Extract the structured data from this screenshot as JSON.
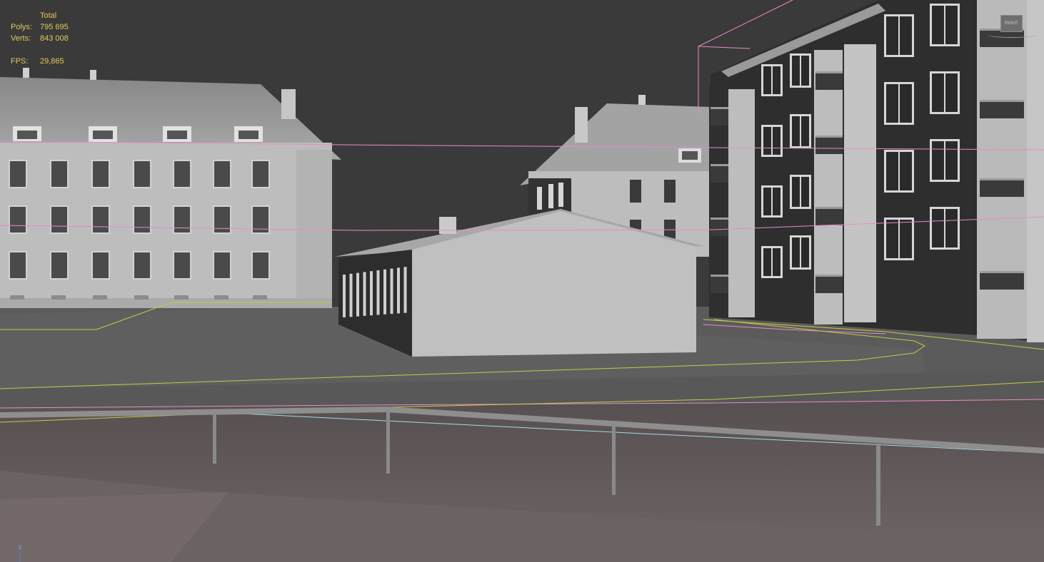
{
  "stats": {
    "header": "Total",
    "polys_label": "Polys:",
    "polys_value": "795 695",
    "verts_label": "Verts:",
    "verts_value": "843 008",
    "fps_label": "FPS:",
    "fps_value": "29,865"
  },
  "axis_label": "z",
  "viewcube": {
    "face_label": "RIGHT"
  },
  "colors": {
    "viewport_bg": "#3a3a3a",
    "stats_text": "#e2c95c",
    "spline_pink": "#e98bc9",
    "spline_yellow": "#c8c84a",
    "spline_cyan": "#9fdde6",
    "facade_light": "#b9b9b9",
    "facade_dark": "#2f2f2f",
    "roof": "#9a9a9a",
    "road": "#606060",
    "terrain": "#5a5353"
  },
  "icons": [
    "view-cube-icon",
    "z-axis-gizmo-icon"
  ]
}
